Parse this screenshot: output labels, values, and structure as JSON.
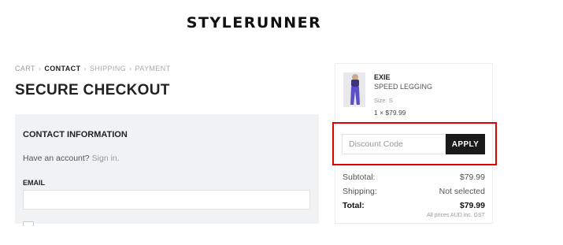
{
  "header": {
    "logo_text": "STYLERUNNER"
  },
  "breadcrumb": {
    "items": [
      "CART",
      "CONTACT",
      "SHIPPING",
      "PAYMENT"
    ],
    "separator": "›",
    "current_index": 1
  },
  "page": {
    "title": "SECURE CHECKOUT"
  },
  "contact": {
    "heading": "CONTACT INFORMATION",
    "account_prompt": "Have an account?",
    "signin_link": "Sign in.",
    "email_label": "EMAIL",
    "email_value": ""
  },
  "summary": {
    "product": {
      "brand": "EXIE",
      "name": "SPEED LEGGING",
      "size": "Size: S",
      "quantity_price": "1 × $79.99",
      "thumb_colors": {
        "bg": "#e9e9ec",
        "garment": "#5b4fc7"
      }
    },
    "discount": {
      "placeholder": "Discount Code",
      "value": "",
      "apply_label": "APPLY",
      "highlight_color": "#e00000"
    },
    "totals": {
      "subtotal_label": "Subtotal:",
      "subtotal_value": "$79.99",
      "shipping_label": "Shipping:",
      "shipping_value": "Not selected",
      "total_label": "Total:",
      "total_value": "$79.99",
      "gst_note": "All prices AUD inc. GST"
    }
  },
  "icons": {
    "product_thumbnail": "legging-product-image"
  }
}
